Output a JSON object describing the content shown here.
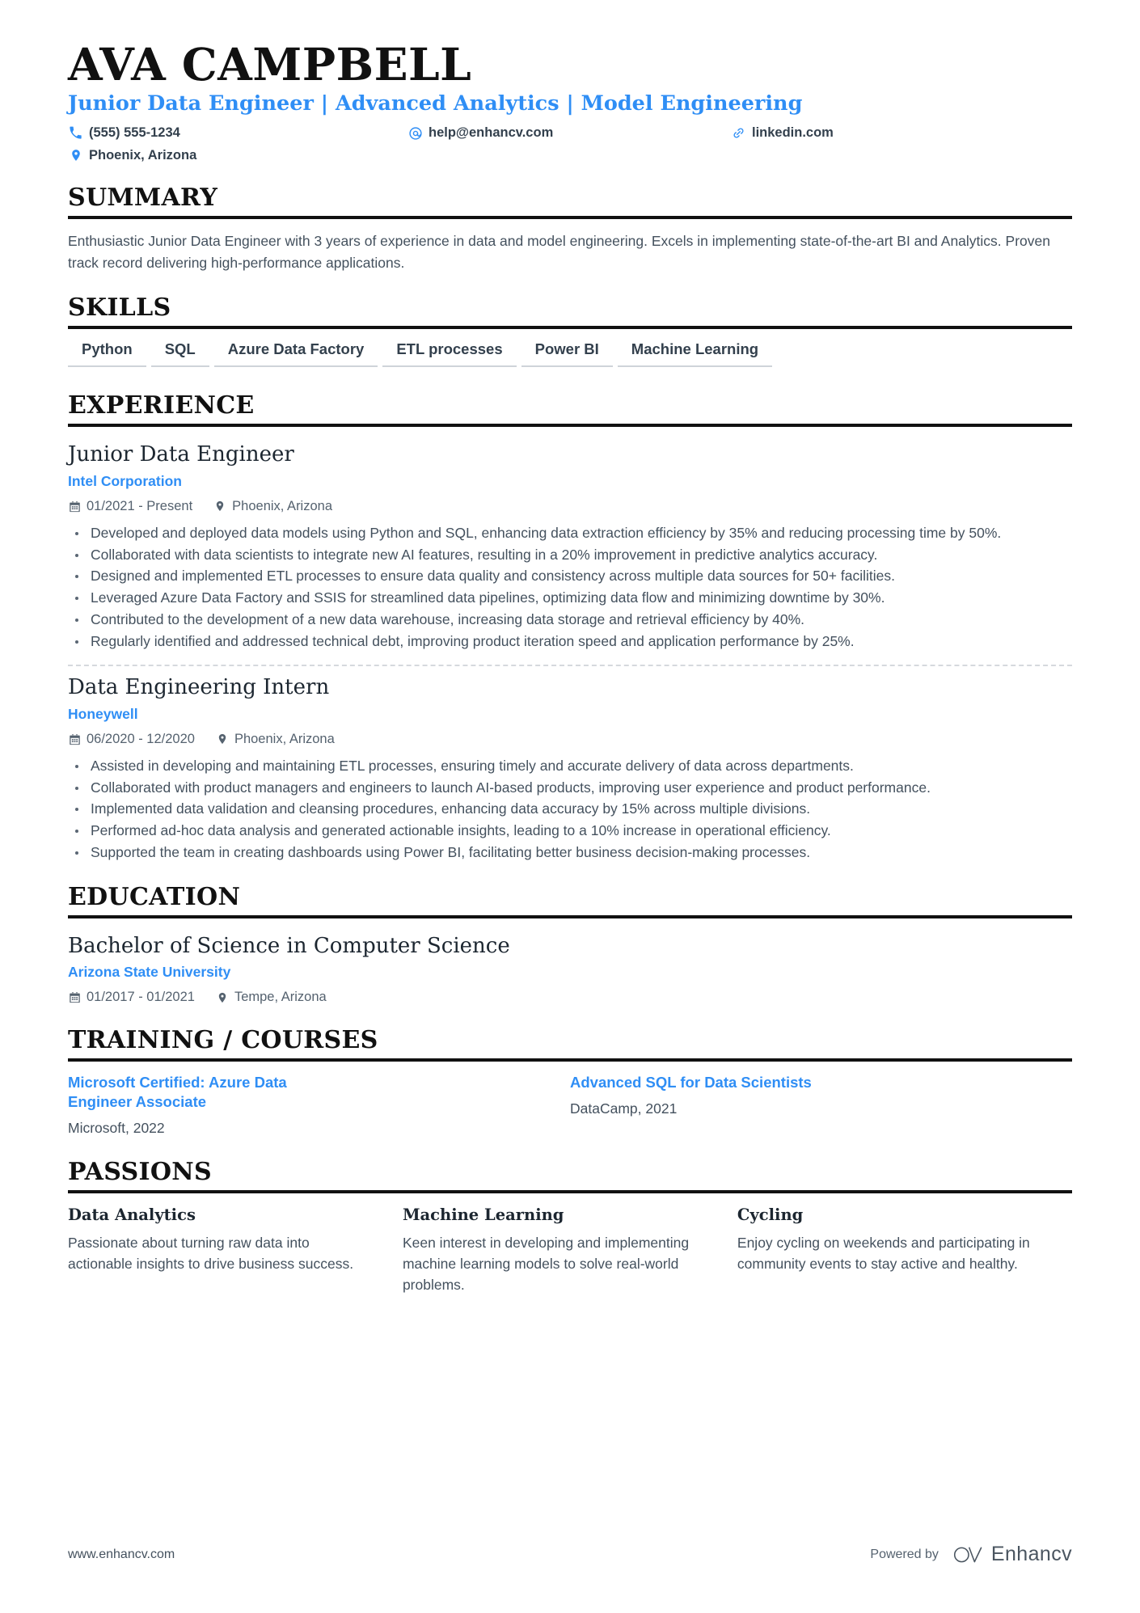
{
  "header": {
    "name": "AVA CAMPBELL",
    "headline": "Junior Data Engineer | Advanced Analytics | Model Engineering",
    "contacts": [
      {
        "icon": "phone-icon",
        "text": "(555) 555-1234"
      },
      {
        "icon": "email-icon",
        "text": "help@enhancv.com"
      },
      {
        "icon": "link-icon",
        "text": "linkedin.com"
      },
      {
        "icon": "location-icon",
        "text": "Phoenix, Arizona"
      }
    ]
  },
  "summary": {
    "title": "SUMMARY",
    "text": "Enthusiastic Junior Data Engineer with 3 years of experience in data and model engineering. Excels in implementing state-of-the-art BI and Analytics. Proven track record delivering high-performance applications."
  },
  "skills": {
    "title": "SKILLS",
    "items": [
      "Python",
      "SQL",
      "Azure Data Factory",
      "ETL processes",
      "Power BI",
      "Machine Learning"
    ]
  },
  "experience": {
    "title": "EXPERIENCE",
    "entries": [
      {
        "role": "Junior Data Engineer",
        "company": "Intel Corporation",
        "dates": "01/2021 - Present",
        "location": "Phoenix, Arizona",
        "bullets": [
          "Developed and deployed data models using Python and SQL, enhancing data extraction efficiency by 35% and reducing processing time by 50%.",
          "Collaborated with data scientists to integrate new AI features, resulting in a 20% improvement in predictive analytics accuracy.",
          "Designed and implemented ETL processes to ensure data quality and consistency across multiple data sources for 50+ facilities.",
          "Leveraged Azure Data Factory and SSIS for streamlined data pipelines, optimizing data flow and minimizing downtime by 30%.",
          "Contributed to the development of a new data warehouse, increasing data storage and retrieval efficiency by 40%.",
          "Regularly identified and addressed technical debt, improving product iteration speed and application performance by 25%."
        ]
      },
      {
        "role": "Data Engineering Intern",
        "company": "Honeywell",
        "dates": "06/2020 - 12/2020",
        "location": "Phoenix, Arizona",
        "bullets": [
          "Assisted in developing and maintaining ETL processes, ensuring timely and accurate delivery of data across departments.",
          "Collaborated with product managers and engineers to launch AI-based products, improving user experience and product performance.",
          "Implemented data validation and cleansing procedures, enhancing data accuracy by 15% across multiple divisions.",
          "Performed ad-hoc data analysis and generated actionable insights, leading to a 10% increase in operational efficiency.",
          "Supported the team in creating dashboards using Power BI, facilitating better business decision-making processes."
        ]
      }
    ]
  },
  "education": {
    "title": "EDUCATION",
    "entries": [
      {
        "degree": "Bachelor of Science in Computer Science",
        "school": "Arizona State University",
        "dates": "01/2017 - 01/2021",
        "location": "Tempe, Arizona"
      }
    ]
  },
  "training": {
    "title": "TRAINING / COURSES",
    "items": [
      {
        "name": "Microsoft Certified: Azure Data Engineer Associate",
        "provider": "Microsoft, 2022"
      },
      {
        "name": "Advanced SQL for Data Scientists",
        "provider": "DataCamp, 2021"
      }
    ]
  },
  "passions": {
    "title": "PASSIONS",
    "items": [
      {
        "name": "Data Analytics",
        "text": "Passionate about turning raw data into actionable insights to drive business success."
      },
      {
        "name": "Machine Learning",
        "text": "Keen interest in developing and implementing machine learning models to solve real-world problems."
      },
      {
        "name": "Cycling",
        "text": "Enjoy cycling on weekends and participating in community events to stay active and healthy."
      }
    ]
  },
  "footer": {
    "url": "www.enhancv.com",
    "powered_by": "Powered by",
    "brand": "Enhancv"
  },
  "colors": {
    "accent_blue": "#2f8ef5",
    "heading_black": "#111111",
    "body_gray": "#44515e",
    "skill_underline": "#cfd4d9"
  }
}
